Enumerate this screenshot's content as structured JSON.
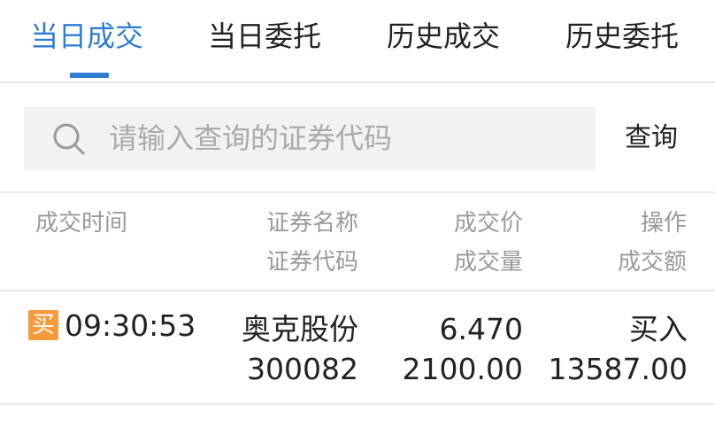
{
  "tabs": [
    {
      "label": "当日成交",
      "active": true
    },
    {
      "label": "当日委托",
      "active": false
    },
    {
      "label": "历史成交",
      "active": false
    },
    {
      "label": "历史委托",
      "active": false
    }
  ],
  "search": {
    "placeholder": "请输入查询的证券代码",
    "value": "",
    "button_label": "查询",
    "icon": "search-icon"
  },
  "table": {
    "headers": {
      "time": "成交时间",
      "name": "证券名称",
      "code": "证券代码",
      "price": "成交价",
      "volume": "成交量",
      "action": "操作",
      "amount": "成交额"
    },
    "rows": [
      {
        "badge": "买",
        "time": "09:30:53",
        "name": "奥克股份",
        "code": "300082",
        "price": "6.470",
        "volume": "2100.00",
        "action": "买入",
        "amount": "13587.00"
      }
    ]
  },
  "colors": {
    "accent": "#2f7dd3",
    "buy_badge": "#f59a3b"
  }
}
